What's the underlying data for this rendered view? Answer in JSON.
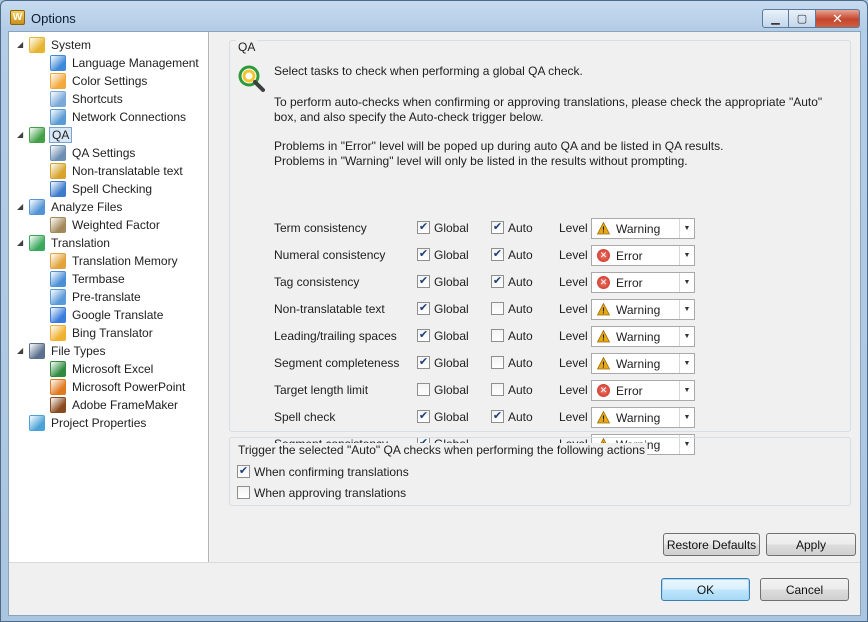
{
  "window": {
    "title": "Options",
    "minimize": "▁",
    "maximize": "▢",
    "close": "✕"
  },
  "tree": [
    {
      "id": "system",
      "label": "System",
      "level": 0,
      "expanded": true,
      "icon": "gear-icon",
      "color": "#e6b52e"
    },
    {
      "id": "language-management",
      "label": "Language Management",
      "level": 1,
      "icon": "globe-icon",
      "color": "#3f8ad8"
    },
    {
      "id": "color-settings",
      "label": "Color Settings",
      "level": 1,
      "icon": "palette-icon",
      "color": "#f2a93b"
    },
    {
      "id": "shortcuts",
      "label": "Shortcuts",
      "level": 1,
      "icon": "keyboard-icon",
      "color": "#7aa9d9"
    },
    {
      "id": "network-connections",
      "label": "Network Connections",
      "level": 1,
      "icon": "network-icon",
      "color": "#5b9bd5"
    },
    {
      "id": "qa",
      "label": "QA",
      "level": 0,
      "expanded": true,
      "selected": true,
      "icon": "qa-magnifier-icon",
      "color": "#43a047"
    },
    {
      "id": "qa-settings",
      "label": "QA Settings",
      "level": 1,
      "icon": "gear-icon",
      "color": "#6d8fb3"
    },
    {
      "id": "non-translatable-text",
      "label": "Non-translatable text",
      "level": 1,
      "icon": "molecule-icon",
      "color": "#d6a42a"
    },
    {
      "id": "spell-checking",
      "label": "Spell Checking",
      "level": 1,
      "icon": "spell-icon",
      "color": "#3d7ccc"
    },
    {
      "id": "analyze-files",
      "label": "Analyze Files",
      "level": 0,
      "expanded": true,
      "icon": "analyze-icon",
      "color": "#5294d6"
    },
    {
      "id": "weighted-factor",
      "label": "Weighted Factor",
      "level": 1,
      "icon": "weight-icon",
      "color": "#a3895a"
    },
    {
      "id": "translation",
      "label": "Translation",
      "level": 0,
      "expanded": true,
      "icon": "translation-icon",
      "color": "#3aa85c"
    },
    {
      "id": "translation-memory",
      "label": "Translation Memory",
      "level": 1,
      "icon": "tm-icon",
      "color": "#e2a33a"
    },
    {
      "id": "termbase",
      "label": "Termbase",
      "level": 1,
      "icon": "termbase-icon",
      "color": "#4b8fd8"
    },
    {
      "id": "pre-translate",
      "label": "Pre-translate",
      "level": 1,
      "icon": "pretranslate-icon",
      "color": "#5a9ad8"
    },
    {
      "id": "google-translate",
      "label": "Google Translate",
      "level": 1,
      "icon": "google-icon",
      "color": "#3b7ddd"
    },
    {
      "id": "bing-translator",
      "label": "Bing Translator",
      "level": 1,
      "icon": "bing-icon",
      "color": "#f1b12f"
    },
    {
      "id": "file-types",
      "label": "File Types",
      "level": 0,
      "expanded": true,
      "icon": "file-types-icon",
      "color": "#5a6f8c"
    },
    {
      "id": "microsoft-excel",
      "label": "Microsoft Excel",
      "level": 1,
      "icon": "excel-icon",
      "color": "#2f8a3e"
    },
    {
      "id": "microsoft-powerpoint",
      "label": "Microsoft PowerPoint",
      "level": 1,
      "icon": "powerpoint-icon",
      "color": "#e07a21"
    },
    {
      "id": "adobe-framemaker",
      "label": "Adobe FrameMaker",
      "level": 1,
      "icon": "framemaker-icon",
      "color": "#8a4a1e"
    },
    {
      "id": "project-properties",
      "label": "Project Properties",
      "level": 0,
      "icon": "cube-icon",
      "color": "#4aa3d8"
    }
  ],
  "qa": {
    "group_title": "QA",
    "desc1": "Select tasks to check when performing a global QA check.",
    "desc2a": "To perform auto-checks when confirming or approving translations, please check the appropriate \"Auto\"",
    "desc2b": "box, and also specify the Auto-check trigger below.",
    "desc3a": "Problems in \"Error\" level will be poped up during auto QA and be listed in QA results.",
    "desc3b": "Problems in \"Warning\" level will only be listed in the results without prompting.",
    "global_label": "Global",
    "auto_label": "Auto",
    "level_label": "Level",
    "rows": [
      {
        "label": "Term consistency",
        "global": true,
        "auto": true,
        "has_auto": true,
        "level": "Warning"
      },
      {
        "label": "Numeral consistency",
        "global": true,
        "auto": true,
        "has_auto": true,
        "level": "Error"
      },
      {
        "label": "Tag consistency",
        "global": true,
        "auto": true,
        "has_auto": true,
        "level": "Error"
      },
      {
        "label": "Non-translatable text",
        "global": true,
        "auto": false,
        "has_auto": true,
        "level": "Warning"
      },
      {
        "label": "Leading/trailing spaces",
        "global": true,
        "auto": false,
        "has_auto": true,
        "level": "Warning"
      },
      {
        "label": "Segment completeness",
        "global": true,
        "auto": false,
        "has_auto": true,
        "level": "Warning"
      },
      {
        "label": "Target length limit",
        "global": false,
        "auto": false,
        "has_auto": true,
        "level": "Error"
      },
      {
        "label": "Spell check",
        "global": true,
        "auto": true,
        "has_auto": true,
        "level": "Warning"
      },
      {
        "label": "Segment consistency",
        "global": true,
        "auto": false,
        "has_auto": false,
        "level": "Warning"
      }
    ]
  },
  "trigger": {
    "title": "Trigger the selected \"Auto\" QA checks when performing the following actions",
    "options": [
      {
        "label": "When confirming translations",
        "checked": true
      },
      {
        "label": "When approving translations",
        "checked": false
      }
    ]
  },
  "buttons": {
    "restore_defaults": "Restore Defaults",
    "apply": "Apply",
    "ok": "OK",
    "cancel": "Cancel"
  },
  "colors": {
    "warning": "#e6a817",
    "error": "#d13a2a",
    "selection": "#d9e8f7"
  }
}
